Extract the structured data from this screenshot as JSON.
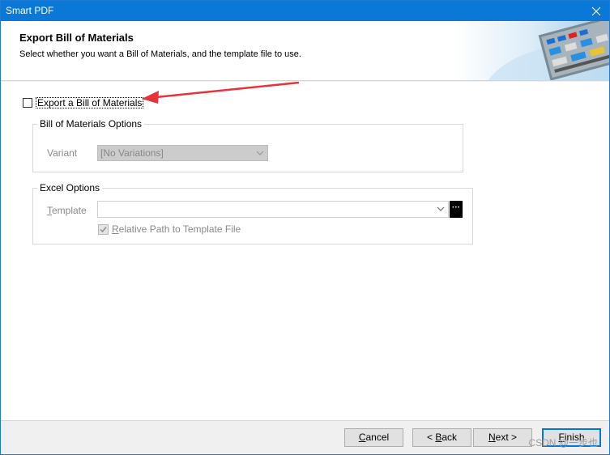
{
  "window": {
    "title": "Smart PDF"
  },
  "header": {
    "title": "Export Bill of Materials",
    "subtitle": "Select whether you want a Bill of Materials, and the template file to use."
  },
  "export_checkbox": {
    "label": "Export a Bill of Materials",
    "checked": false
  },
  "bom_options": {
    "legend": "Bill of Materials Options",
    "variant_label": "Variant",
    "variant_value": "[No Variations]"
  },
  "excel_options": {
    "legend": "Excel Options",
    "template_label": "Template",
    "template_value": "",
    "relative_path_label": "Relative Path to Template File",
    "relative_path_checked": true
  },
  "footer": {
    "cancel_label": "Cancel",
    "back_label": "< Back",
    "next_label": "Next >",
    "finish_label": "Finish"
  },
  "watermark": "CSDN @一步也",
  "colors": {
    "title_bar": "#0a78d7",
    "annotation_arrow": "#e8323c",
    "disabled_field": "#cccccc"
  }
}
